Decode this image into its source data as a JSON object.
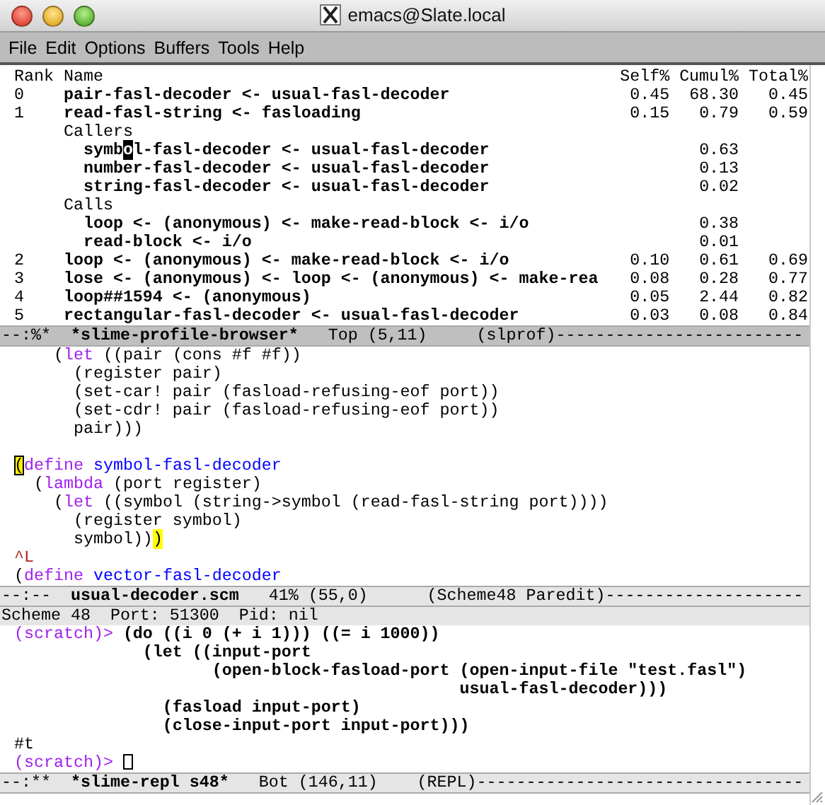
{
  "window": {
    "title": "emacs@Slate.local"
  },
  "menu": [
    "File",
    "Edit",
    "Options",
    "Buffers",
    "Tools",
    "Help"
  ],
  "profile": {
    "columns": [
      "Rank",
      "Name",
      "Self%",
      "Cumul%",
      "Total%"
    ],
    "rows": [
      {
        "kind": "row",
        "rank": "0",
        "name": "pair-fasl-decoder <- usual-fasl-decoder",
        "self": "0.45",
        "cumul": "68.30",
        "total": "0.45"
      },
      {
        "kind": "row",
        "rank": "1",
        "name": "read-fasl-string <- fasloading",
        "self": "0.15",
        "cumul": "0.79",
        "total": "0.59"
      },
      {
        "kind": "section",
        "name": "Callers"
      },
      {
        "kind": "sub",
        "name": "symb",
        "cursor": "o",
        "name_tail": "l-fasl-decoder <- usual-fasl-decoder",
        "cumul": "0.63"
      },
      {
        "kind": "sub",
        "name": "number-fasl-decoder <- usual-fasl-decoder",
        "cumul": "0.13"
      },
      {
        "kind": "sub",
        "name": "string-fasl-decoder <- usual-fasl-decoder",
        "cumul": "0.02"
      },
      {
        "kind": "section",
        "name": "Calls"
      },
      {
        "kind": "sub",
        "name": "loop <- (anonymous) <- make-read-block <- i/o",
        "cumul": "0.38"
      },
      {
        "kind": "sub",
        "name": "read-block <- i/o",
        "cumul": "0.01"
      },
      {
        "kind": "row",
        "rank": "2",
        "name": "loop <- (anonymous) <- make-read-block <- i/o",
        "self": "0.10",
        "cumul": "0.61",
        "total": "0.69"
      },
      {
        "kind": "row",
        "rank": "3",
        "name": "lose <- (anonymous) <- loop <- (anonymous) <- make-rea",
        "self": "0.08",
        "cumul": "0.28",
        "total": "0.77"
      },
      {
        "kind": "row",
        "rank": "4",
        "name": "loop##1594 <- (anonymous)",
        "self": "0.05",
        "cumul": "2.44",
        "total": "0.82"
      },
      {
        "kind": "row",
        "rank": "5",
        "name": "rectangular-fasl-decoder <- usual-fasl-decoder",
        "self": "0.03",
        "cumul": "0.08",
        "total": "0.84"
      }
    ],
    "mode_line": {
      "active": true,
      "segments": [
        {
          "text": "--:%*  ",
          "bold": false
        },
        {
          "text": "*slime-profile-browser*",
          "bold": true
        },
        {
          "text": "   Top (5,11)     (slprof)-------------------------",
          "bold": false
        }
      ]
    }
  },
  "source": {
    "lines": [
      [
        {
          "kind": "plain",
          "text": "    ("
        },
        {
          "kind": "keyword",
          "text": "let"
        },
        {
          "kind": "plain",
          "text": " ((pair (cons #f #f))"
        }
      ],
      [
        {
          "kind": "plain",
          "text": "      (register pair)"
        }
      ],
      [
        {
          "kind": "plain",
          "text": "      (set-car! pair (fasload-refusing-eof port))"
        }
      ],
      [
        {
          "kind": "plain",
          "text": "      (set-cdr! pair (fasload-refusing-eof port))"
        }
      ],
      [
        {
          "kind": "plain",
          "text": "      pair)))"
        }
      ],
      [
        {
          "kind": "cursor",
          "text": "(",
          "gap_before": true
        },
        {
          "kind": "keyword",
          "text": "define"
        },
        {
          "kind": "function-name",
          "text": " symbol-fasl-decoder"
        }
      ],
      [
        {
          "kind": "plain",
          "text": "  ("
        },
        {
          "kind": "keyword",
          "text": "lambda"
        },
        {
          "kind": "plain",
          "text": " (port register)"
        }
      ],
      [
        {
          "kind": "plain",
          "text": "    ("
        },
        {
          "kind": "keyword",
          "text": "let"
        },
        {
          "kind": "plain",
          "text": " ((symbol (string->symbol (read-fasl-string port))))"
        }
      ],
      [
        {
          "kind": "plain",
          "text": "      (register symbol)"
        }
      ],
      [
        {
          "kind": "plain",
          "text": "      symbol))"
        },
        {
          "kind": "paren-match",
          "text": ")"
        }
      ],
      [
        {
          "kind": "control-char",
          "text": "^L"
        }
      ],
      [
        {
          "kind": "plain",
          "text": "("
        },
        {
          "kind": "keyword",
          "text": "define"
        },
        {
          "kind": "function-name",
          "text": " vector-fasl-decoder"
        }
      ]
    ],
    "mode_line": {
      "active": false,
      "segments": [
        {
          "text": "--:--  ",
          "bold": false
        },
        {
          "text": "usual-decoder.scm",
          "bold": true
        },
        {
          "text": "   41% (55,0)      (Scheme48 Paredit)--------------------",
          "bold": false
        }
      ]
    }
  },
  "repl": {
    "header": "Scheme 48  Port: 51300  Pid: nil",
    "lines": [
      {
        "prompt": "(scratch)>",
        "input": "(do ((i 0 (+ i 1))) ((= i 1000))"
      },
      {
        "input": "             (let ((input-port"
      },
      {
        "input": "                    (open-block-fasload-port (open-input-file \"test.fasl\")"
      },
      {
        "input": "                                             usual-fasl-decoder)))"
      },
      {
        "input": "               (fasload input-port)"
      },
      {
        "input": "               (close-input-port input-port)))"
      },
      {
        "output": "#t"
      },
      {
        "prompt": "(scratch)>",
        "cursor": true
      }
    ],
    "mode_line": {
      "active": false,
      "segments": [
        {
          "text": "--:**  ",
          "bold": false
        },
        {
          "text": "*slime-repl s48*",
          "bold": true
        },
        {
          "text": "   Bot (146,11)    (REPL)---------------------------------",
          "bold": false
        }
      ]
    }
  }
}
